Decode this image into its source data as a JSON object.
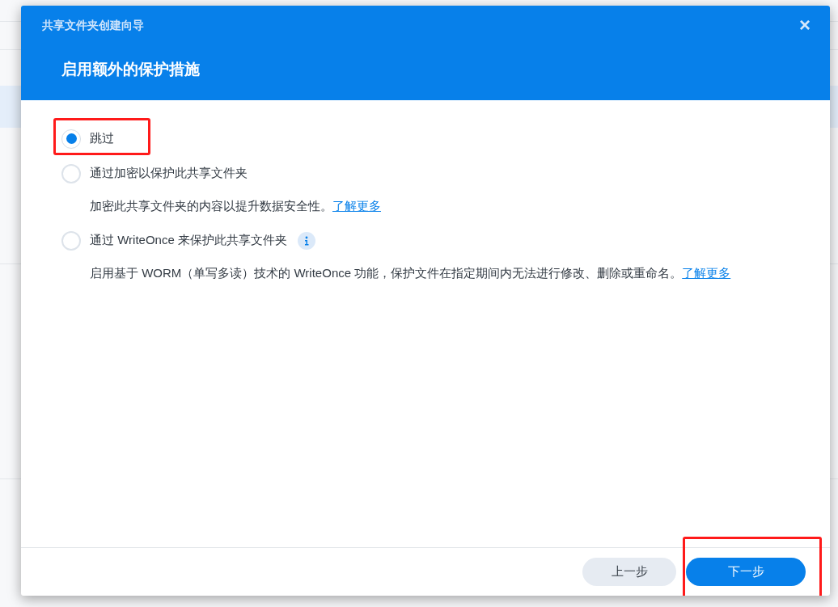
{
  "dialog": {
    "title": "共享文件夹创建向导",
    "heading": "启用额外的保护措施",
    "close": "×"
  },
  "options": [
    {
      "label": "跳过",
      "selected": true,
      "highlighted": true
    },
    {
      "label": "通过加密以保护此共享文件夹",
      "selected": false,
      "description": "加密此共享文件夹的内容以提升数据安全性。",
      "link": "了解更多"
    },
    {
      "label": "通过 WriteOnce 来保护此共享文件夹",
      "selected": false,
      "info": true,
      "description": "启用基于 WORM（单写多读）技术的 WriteOnce 功能，保护文件在指定期间内无法进行修改、删除或重命名。",
      "link": "了解更多"
    }
  ],
  "buttons": [
    {
      "label": "上一步",
      "kind": "secondary"
    },
    {
      "label": "下一步",
      "kind": "primary",
      "highlighted": true
    }
  ]
}
